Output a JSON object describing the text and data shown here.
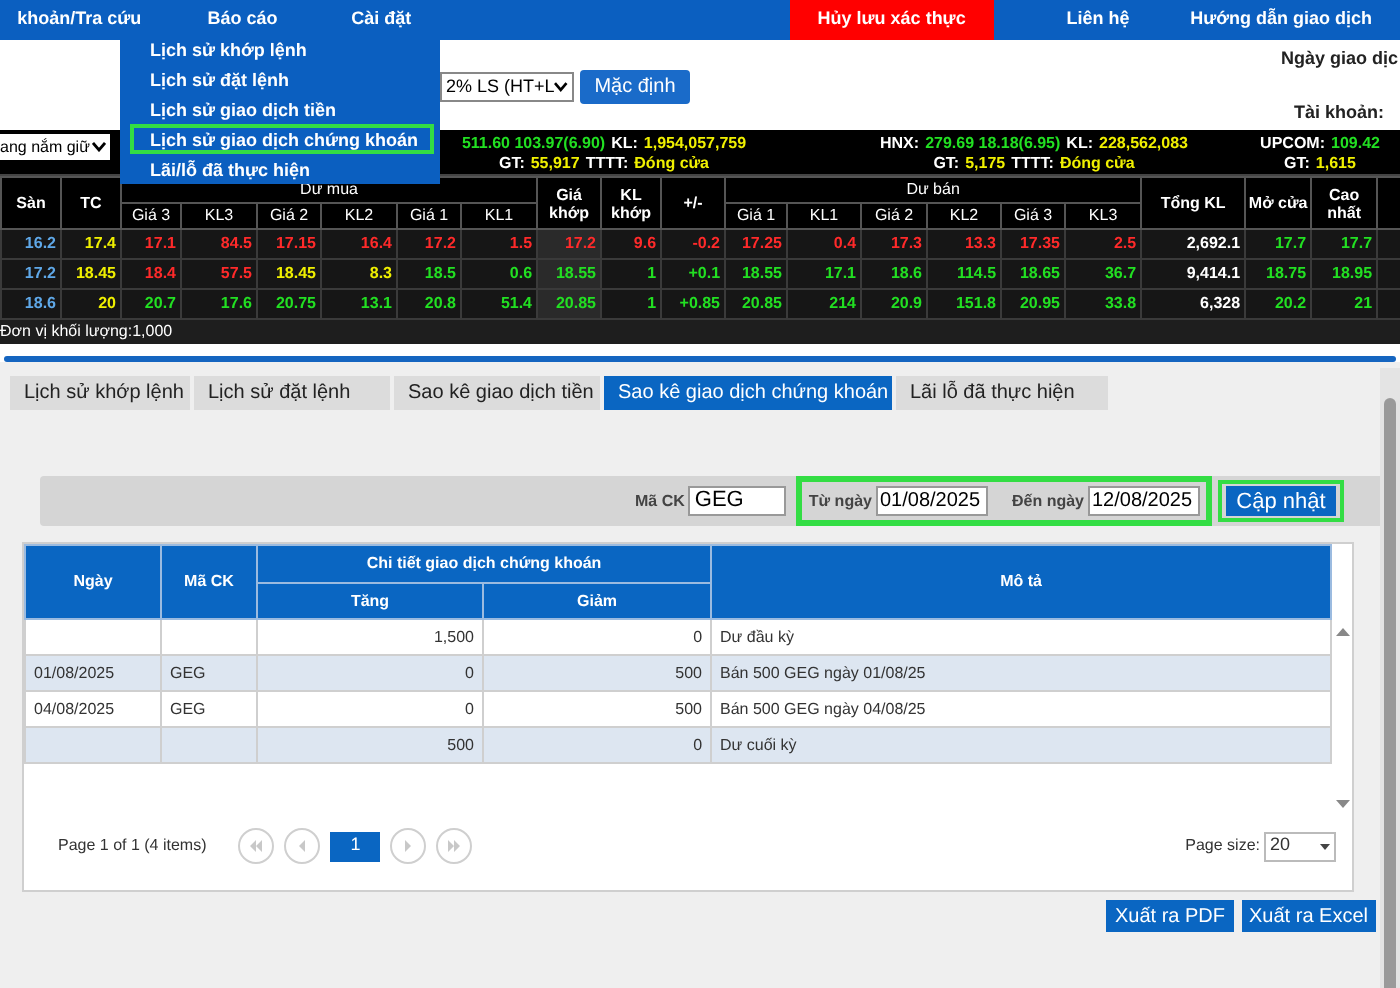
{
  "nav": {
    "items": [
      {
        "label": "khoản/Tra cứu",
        "kind": "menu"
      },
      {
        "label": "Báo cáo",
        "kind": "menu"
      },
      {
        "label": "Cài đặt",
        "kind": "menu"
      },
      {
        "label": "Hủy lưu xác thực",
        "kind": "alert"
      },
      {
        "label": "Liên hệ",
        "kind": "menu"
      },
      {
        "label": "Hướng dẫn giao dịch",
        "kind": "menu"
      }
    ]
  },
  "report_menu": {
    "items": [
      {
        "label": "Lịch sử khớp lệnh",
        "highlighted": false
      },
      {
        "label": "Lịch sử đặt lệnh",
        "highlighted": false
      },
      {
        "label": "Lịch sử giao dịch tiền",
        "highlighted": false
      },
      {
        "label": "Lịch sử giao dịch chứng khoán",
        "highlighted": true
      },
      {
        "label": "Lãi/lỗ đã thực hiện",
        "highlighted": false
      }
    ]
  },
  "header": {
    "margin_select": "2% LS (HT+L",
    "default_button": "Mặc định",
    "trade_date_label": "Ngày giao dịc",
    "account_label": "Tài khoản:"
  },
  "board": {
    "holding_select": "ang nắm giữ",
    "indices": [
      {
        "lines": [
          [
            {
              "text": "511.60  103.97(6.90)",
              "color": "#22e022"
            },
            {
              "text": "KL:",
              "color": "#ffffff"
            },
            {
              "text": "1,954,057,759",
              "color": "#f0f000"
            }
          ],
          [
            {
              "text": "GT:",
              "color": "#ffffff"
            },
            {
              "text": "55,917",
              "color": "#f0f000"
            },
            {
              "text": "TTTT:",
              "color": "#ffffff"
            },
            {
              "text": "Đóng cửa",
              "color": "#f0f000"
            }
          ]
        ]
      },
      {
        "lines": [
          [
            {
              "text": "HNX:",
              "color": "#ffffff"
            },
            {
              "text": "279.69  18.18(6.95)",
              "color": "#22e022"
            },
            {
              "text": "KL:",
              "color": "#ffffff"
            },
            {
              "text": "228,562,083",
              "color": "#f0f000"
            }
          ],
          [
            {
              "text": "GT:",
              "color": "#ffffff"
            },
            {
              "text": "5,175",
              "color": "#f0f000"
            },
            {
              "text": "TTTT:",
              "color": "#ffffff"
            },
            {
              "text": "Đóng cửa",
              "color": "#f0f000"
            }
          ]
        ]
      },
      {
        "lines": [
          [
            {
              "text": "UPCOM:",
              "color": "#ffffff"
            },
            {
              "text": "109.42",
              "color": "#22e022"
            }
          ],
          [
            {
              "text": "GT:",
              "color": "#ffffff"
            },
            {
              "text": "1,615",
              "color": "#f0f000"
            }
          ]
        ]
      }
    ],
    "column_groups": [
      {
        "label": "Dư mua"
      },
      {
        "label": "Dư bán"
      }
    ],
    "columns": [
      {
        "label": "Sàn",
        "kind": "single"
      },
      {
        "label": "TC",
        "kind": "single"
      },
      {
        "label": "Giá 3",
        "kind": "sub"
      },
      {
        "label": "KL3",
        "kind": "sub"
      },
      {
        "label": "Giá 2",
        "kind": "sub"
      },
      {
        "label": "KL2",
        "kind": "sub"
      },
      {
        "label": "Giá 1",
        "kind": "sub"
      },
      {
        "label": "KL1",
        "kind": "sub"
      },
      {
        "label": "Giá khớp",
        "kind": "single"
      },
      {
        "label": "KL khớp",
        "kind": "single"
      },
      {
        "label": "+/-",
        "kind": "single"
      },
      {
        "label": "Giá 1",
        "kind": "sub"
      },
      {
        "label": "KL1",
        "kind": "sub"
      },
      {
        "label": "Giá 2",
        "kind": "sub"
      },
      {
        "label": "KL2",
        "kind": "sub"
      },
      {
        "label": "Giá 3",
        "kind": "sub"
      },
      {
        "label": "KL3",
        "kind": "sub"
      },
      {
        "label": "Tổng KL",
        "kind": "single"
      },
      {
        "label": "Mở cửa",
        "kind": "single"
      },
      {
        "label": "Cao nhất",
        "kind": "single"
      }
    ],
    "rows": [
      [
        {
          "text": "16.2",
          "color": "#5fa8e8"
        },
        {
          "text": "17.4",
          "color": "#f0f000"
        },
        {
          "text": "17.1",
          "color": "#ff2a2a"
        },
        {
          "text": "84.5",
          "color": "#ff2a2a"
        },
        {
          "text": "17.15",
          "color": "#ff2a2a"
        },
        {
          "text": "16.4",
          "color": "#ff2a2a"
        },
        {
          "text": "17.2",
          "color": "#ff2a2a"
        },
        {
          "text": "1.5",
          "color": "#ff2a2a"
        },
        {
          "text": "17.2",
          "color": "#ff2a2a"
        },
        {
          "text": "9.6",
          "color": "#ff2a2a"
        },
        {
          "text": "-0.2",
          "color": "#ff2a2a"
        },
        {
          "text": "17.25",
          "color": "#ff2a2a"
        },
        {
          "text": "0.4",
          "color": "#ff2a2a"
        },
        {
          "text": "17.3",
          "color": "#ff2a2a"
        },
        {
          "text": "13.3",
          "color": "#ff2a2a"
        },
        {
          "text": "17.35",
          "color": "#ff2a2a"
        },
        {
          "text": "2.5",
          "color": "#ff2a2a"
        },
        {
          "text": "2,692.1",
          "color": "#ffffff"
        },
        {
          "text": "17.7",
          "color": "#22e022"
        },
        {
          "text": "17.7",
          "color": "#22e022"
        }
      ],
      [
        {
          "text": "17.2",
          "color": "#5fa8e8"
        },
        {
          "text": "18.45",
          "color": "#f0f000"
        },
        {
          "text": "18.4",
          "color": "#ff2a2a"
        },
        {
          "text": "57.5",
          "color": "#ff2a2a"
        },
        {
          "text": "18.45",
          "color": "#f0f000"
        },
        {
          "text": "8.3",
          "color": "#f0f000"
        },
        {
          "text": "18.5",
          "color": "#22e022"
        },
        {
          "text": "0.6",
          "color": "#22e022"
        },
        {
          "text": "18.55",
          "color": "#22e022"
        },
        {
          "text": "1",
          "color": "#22e022"
        },
        {
          "text": "+0.1",
          "color": "#22e022"
        },
        {
          "text": "18.55",
          "color": "#22e022"
        },
        {
          "text": "17.1",
          "color": "#22e022"
        },
        {
          "text": "18.6",
          "color": "#22e022"
        },
        {
          "text": "114.5",
          "color": "#22e022"
        },
        {
          "text": "18.65",
          "color": "#22e022"
        },
        {
          "text": "36.7",
          "color": "#22e022"
        },
        {
          "text": "9,414.1",
          "color": "#ffffff"
        },
        {
          "text": "18.75",
          "color": "#22e022"
        },
        {
          "text": "18.95",
          "color": "#22e022"
        }
      ],
      [
        {
          "text": "18.6",
          "color": "#5fa8e8"
        },
        {
          "text": "20",
          "color": "#f0f000"
        },
        {
          "text": "20.7",
          "color": "#22e022"
        },
        {
          "text": "17.6",
          "color": "#22e022"
        },
        {
          "text": "20.75",
          "color": "#22e022"
        },
        {
          "text": "13.1",
          "color": "#22e022"
        },
        {
          "text": "20.8",
          "color": "#22e022"
        },
        {
          "text": "51.4",
          "color": "#22e022"
        },
        {
          "text": "20.85",
          "color": "#22e022"
        },
        {
          "text": "1",
          "color": "#22e022"
        },
        {
          "text": "+0.85",
          "color": "#22e022"
        },
        {
          "text": "20.85",
          "color": "#22e022"
        },
        {
          "text": "214",
          "color": "#22e022"
        },
        {
          "text": "20.9",
          "color": "#22e022"
        },
        {
          "text": "151.8",
          "color": "#22e022"
        },
        {
          "text": "20.95",
          "color": "#22e022"
        },
        {
          "text": "33.8",
          "color": "#22e022"
        },
        {
          "text": "6,328",
          "color": "#ffffff"
        },
        {
          "text": "20.2",
          "color": "#22e022"
        },
        {
          "text": "21",
          "color": "#22e022"
        }
      ]
    ],
    "unit_note": "Đơn vị khối lượng:1,000"
  },
  "tabs": [
    {
      "label": "Lịch sử khớp lệnh",
      "selected": false
    },
    {
      "label": "Lịch sử đặt lệnh",
      "selected": false
    },
    {
      "label": "Sao kê giao dịch tiền",
      "selected": false
    },
    {
      "label": "Sao kê giao dịch chứng khoán",
      "selected": true
    },
    {
      "label": "Lãi lỗ đã thực hiện",
      "selected": false
    }
  ],
  "filter": {
    "symbol": {
      "label": "Mã CK",
      "value": "GEG"
    },
    "date_range": {
      "highlighted": true,
      "from_label": "Từ ngày",
      "from_value": "01/08/2025",
      "to_label": "Đến ngày",
      "to_value": "12/08/2025"
    },
    "update_button": {
      "label": "Cập nhật",
      "highlighted": true
    }
  },
  "table": {
    "columns": {
      "date": "Ngày",
      "symbol": "Mã CK",
      "detail_group": "Chi tiết giao dịch chứng khoán",
      "increase": "Tăng",
      "decrease": "Giảm",
      "description": "Mô tả"
    },
    "rows": [
      {
        "increase": "1,500",
        "decrease": "0",
        "description": "Dư đầu kỳ"
      },
      {
        "date": "01/08/2025",
        "symbol": "GEG",
        "increase": "0",
        "decrease": "500",
        "description": "Bán 500 GEG ngày 01/08/25"
      },
      {
        "date": "04/08/2025",
        "symbol": "GEG",
        "increase": "0",
        "decrease": "500",
        "description": "Bán 500 GEG ngày 04/08/25"
      },
      {
        "increase": "500",
        "decrease": "0",
        "description": "Dư cuối kỳ"
      }
    ]
  },
  "pager": {
    "summary": "Page 1 of 1 (4 items)",
    "pages": [
      {
        "label": "1",
        "selected": true
      }
    ],
    "page_size_label": "Page size:",
    "page_size": "20"
  },
  "export_buttons": [
    "Xuất ra PDF",
    "Xuất ra Excel"
  ]
}
